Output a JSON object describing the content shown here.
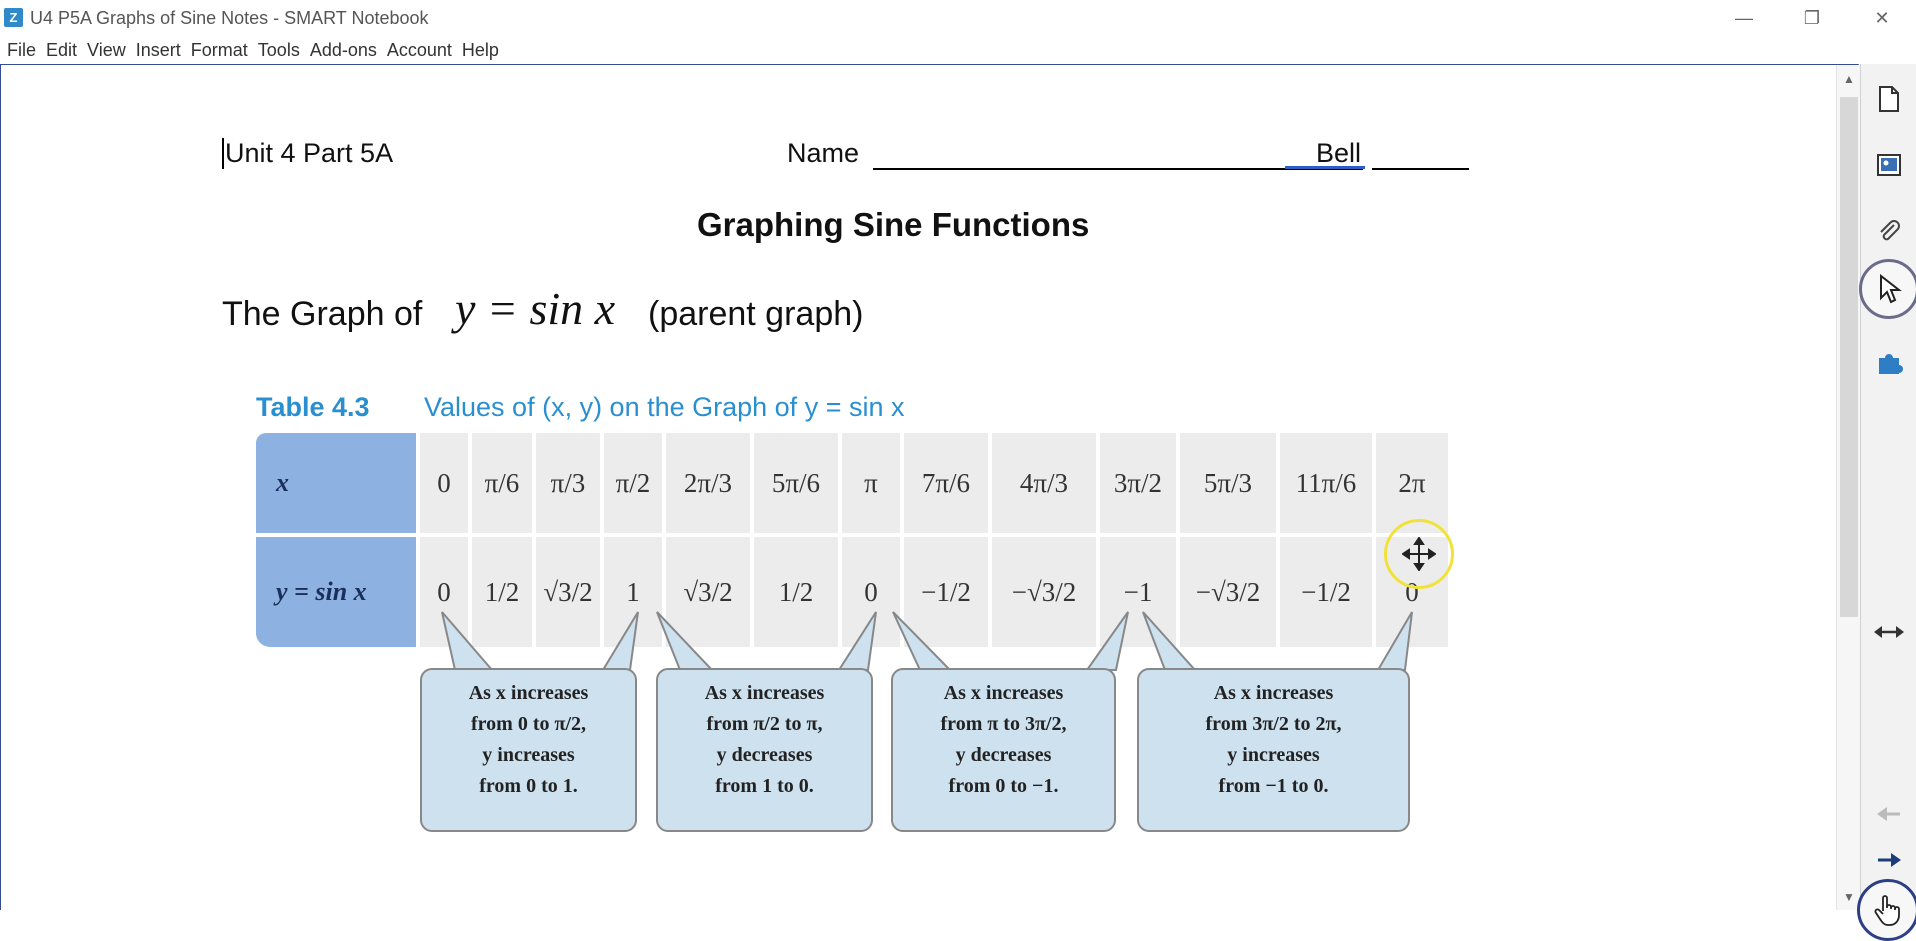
{
  "window": {
    "title": "U4 P5A Graphs of Sine Notes - SMART Notebook",
    "app_icon": "Z",
    "minimize_icon": "—",
    "restore_icon": "❐",
    "close_icon": "✕"
  },
  "menu": [
    "File",
    "Edit",
    "View",
    "Insert",
    "Format",
    "Tools",
    "Add-ons",
    "Account",
    "Help"
  ],
  "doc": {
    "unit": "Unit 4 Part 5A",
    "name_label": "Name",
    "name_value": "Bell",
    "title": "Graphing Sine Functions",
    "graph_prefix": "The Graph of",
    "graph_equation": "y = sin x",
    "graph_suffix": "(parent graph)",
    "table_title": "Table 4.3",
    "table_caption": "Values of (x, y) on the Graph of y = sin x",
    "row_x_label": "x",
    "row_y_label": "y = sin x",
    "x_values": [
      "0",
      "π/6",
      "π/3",
      "π/2",
      "2π/3",
      "5π/6",
      "π",
      "7π/6",
      "4π/3",
      "3π/2",
      "5π/3",
      "11π/6",
      "2π"
    ],
    "y_values": [
      "0",
      "1/2",
      "√3/2",
      "1",
      "√3/2",
      "1/2",
      "0",
      "−1/2",
      "−√3/2",
      "−1",
      "−√3/2",
      "−1/2",
      "0"
    ],
    "callouts": [
      "As x increases\nfrom 0 to π/2,\ny increases\nfrom 0 to 1.",
      "As x increases\nfrom π/2 to π,\ny decreases\nfrom 1 to 0.",
      "As x increases\nfrom π to 3π/2,\ny decreases\nfrom 0 to −1.",
      "As x increases\nfrom 3π/2 to 2π,\ny increases\nfrom −1 to 0."
    ]
  },
  "side_tabs": [
    "page-sorter-icon",
    "gallery-icon",
    "attachments-icon",
    "select-tool-icon",
    "addons-icon",
    "resize-arrows-icon",
    "previous-page-icon",
    "next-page-icon",
    "hand-tool-icon"
  ]
}
